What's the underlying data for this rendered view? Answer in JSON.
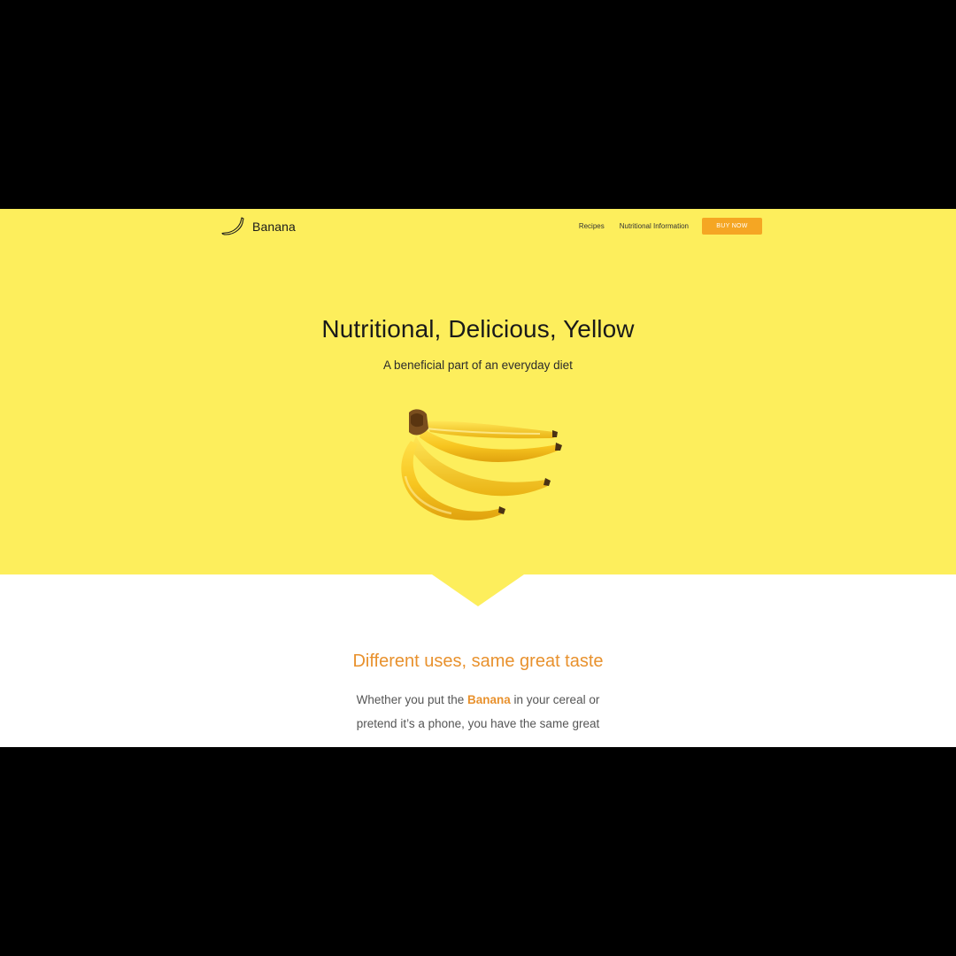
{
  "colors": {
    "hero_background": "#fdee5c",
    "accent": "#f5a623",
    "section_title": "#e8912d",
    "highlight": "#e8912d"
  },
  "nav": {
    "brand": "Banana",
    "logo_icon": "banana-outline-icon",
    "links": [
      "Recipes",
      "Nutritional Information"
    ],
    "cta_label": "BUY NOW"
  },
  "hero": {
    "title": "Nutritional, Delicious, Yellow",
    "subtitle": "A beneficial part of an everyday diet",
    "image": "banana-bunch"
  },
  "section": {
    "title": "Different uses, same great taste",
    "body_before": "Whether you put the ",
    "body_highlight": "Banana",
    "body_after": " in your cereal or pretend it’s a phone, you have the same great"
  }
}
